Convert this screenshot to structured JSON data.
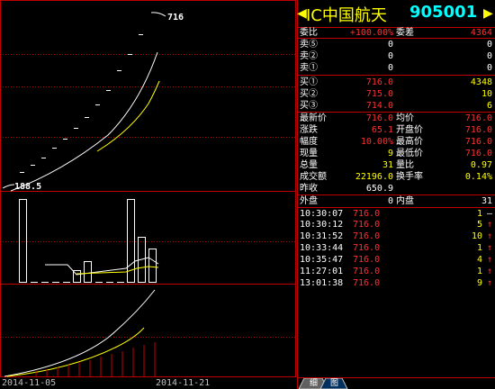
{
  "stock": {
    "name": "IC中国航天",
    "code": "905001"
  },
  "header_arrows": {
    "left": "◀",
    "right": "▶"
  },
  "chart": {
    "price_high_label": "716",
    "price_low_label": "188.5",
    "date_start": "2014-11-05",
    "date_end": "2014-11-21",
    "colors": {
      "grid": "#c00000",
      "price": "#ffffff",
      "avg": "#ffff00",
      "vol": "#c00000"
    }
  },
  "quote": {
    "weibi_label": "委比",
    "weibi_value": "+100.00%",
    "weicha_label": "委差",
    "weicha_value": "4364",
    "sells": [
      {
        "label": "卖⑤",
        "price": "0",
        "vol": "0"
      },
      {
        "label": "卖②",
        "price": "0",
        "vol": "0"
      },
      {
        "label": "卖①",
        "price": "0",
        "vol": "0"
      }
    ],
    "buys": [
      {
        "label": "买①",
        "price": "716.0",
        "vol": "4348"
      },
      {
        "label": "买②",
        "price": "715.0",
        "vol": "10"
      },
      {
        "label": "买③",
        "price": "714.0",
        "vol": "6"
      }
    ],
    "stats": [
      {
        "l1": "最新价",
        "v1": "716.0",
        "l2": "均价",
        "v2": "716.0"
      },
      {
        "l1": "涨跌",
        "v1": "65.1",
        "l2": "开盘价",
        "v2": "716.0"
      },
      {
        "l1": "幅度",
        "v1": "10.00%",
        "l2": "最高价",
        "v2": "716.0"
      },
      {
        "l1": "现量",
        "v1": "9",
        "l2": "最低价",
        "v2": "716.0"
      },
      {
        "l1": "总量",
        "v1": "31",
        "l2": "量比",
        "v2": "0.97"
      },
      {
        "l1": "成交额",
        "v1": "22196.0",
        "l2": "换手率",
        "v2": "0.14%"
      },
      {
        "l1": "昨收",
        "v1": "650.9",
        "l2": "",
        "v2": ""
      }
    ],
    "outer_label": "外盘",
    "outer_value": "0",
    "inner_label": "内盘",
    "inner_value": "31"
  },
  "ticks": [
    {
      "time": "10:30:07",
      "price": "716.0",
      "vol": "1",
      "dir": "–"
    },
    {
      "time": "10:30:12",
      "price": "716.0",
      "vol": "5",
      "dir": "↑"
    },
    {
      "time": "10:31:52",
      "price": "716.0",
      "vol": "10",
      "dir": "↑"
    },
    {
      "time": "10:33:44",
      "price": "716.0",
      "vol": "1",
      "dir": "↑"
    },
    {
      "time": "10:35:47",
      "price": "716.0",
      "vol": "4",
      "dir": "↑"
    },
    {
      "time": "11:27:01",
      "price": "716.0",
      "vol": "1",
      "dir": "↑"
    },
    {
      "time": "13:01:38",
      "price": "716.0",
      "vol": "9",
      "dir": "↑"
    }
  ],
  "tabs": {
    "detail": "细",
    "chart": "图"
  }
}
